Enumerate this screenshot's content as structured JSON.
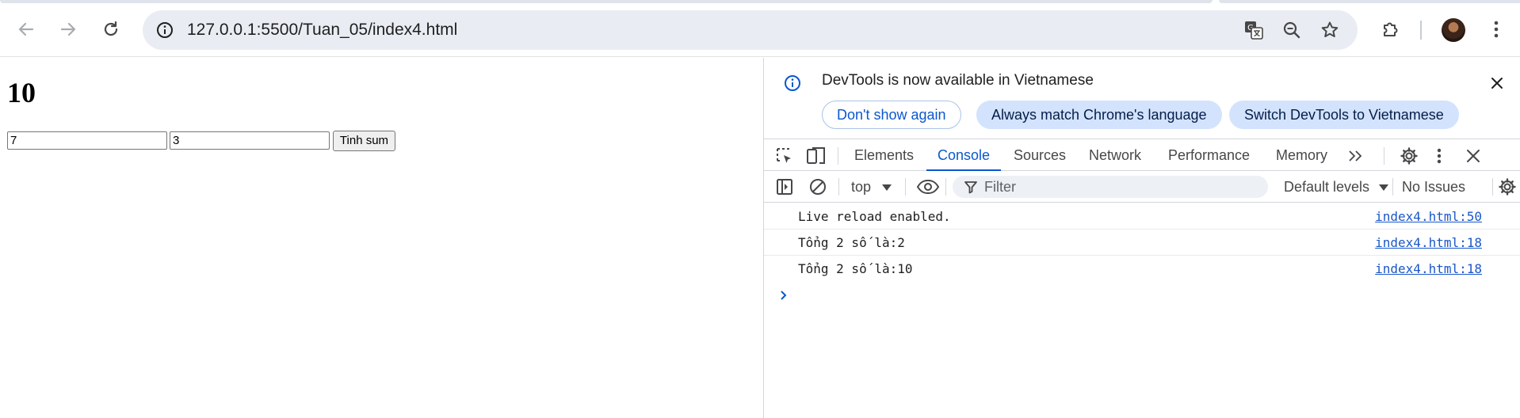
{
  "browser": {
    "url": "127.0.0.1:5500/Tuan_05/index4.html"
  },
  "page": {
    "result": "10",
    "input_a": "7",
    "input_b": "3",
    "button_label": "Tinh sum"
  },
  "devtools": {
    "infobar": {
      "message": "DevTools is now available in Vietnamese",
      "dont_show": "Don't show again",
      "always_match": "Always match Chrome's language",
      "switch": "Switch DevTools to Vietnamese"
    },
    "tabs": [
      "Elements",
      "Console",
      "Sources",
      "Network",
      "Performance",
      "Memory"
    ],
    "active_tab": "Console",
    "console_bar": {
      "context": "top",
      "filter_placeholder": "Filter",
      "levels": "Default levels",
      "issues": "No Issues"
    },
    "logs": [
      {
        "text": "Live reload enabled.",
        "source": "index4.html:50"
      },
      {
        "text": "Tổng 2 số là:2",
        "source": "index4.html:18"
      },
      {
        "text": "Tổng 2 số là:10",
        "source": "index4.html:18"
      }
    ],
    "accent_color": "#0b57d0"
  }
}
